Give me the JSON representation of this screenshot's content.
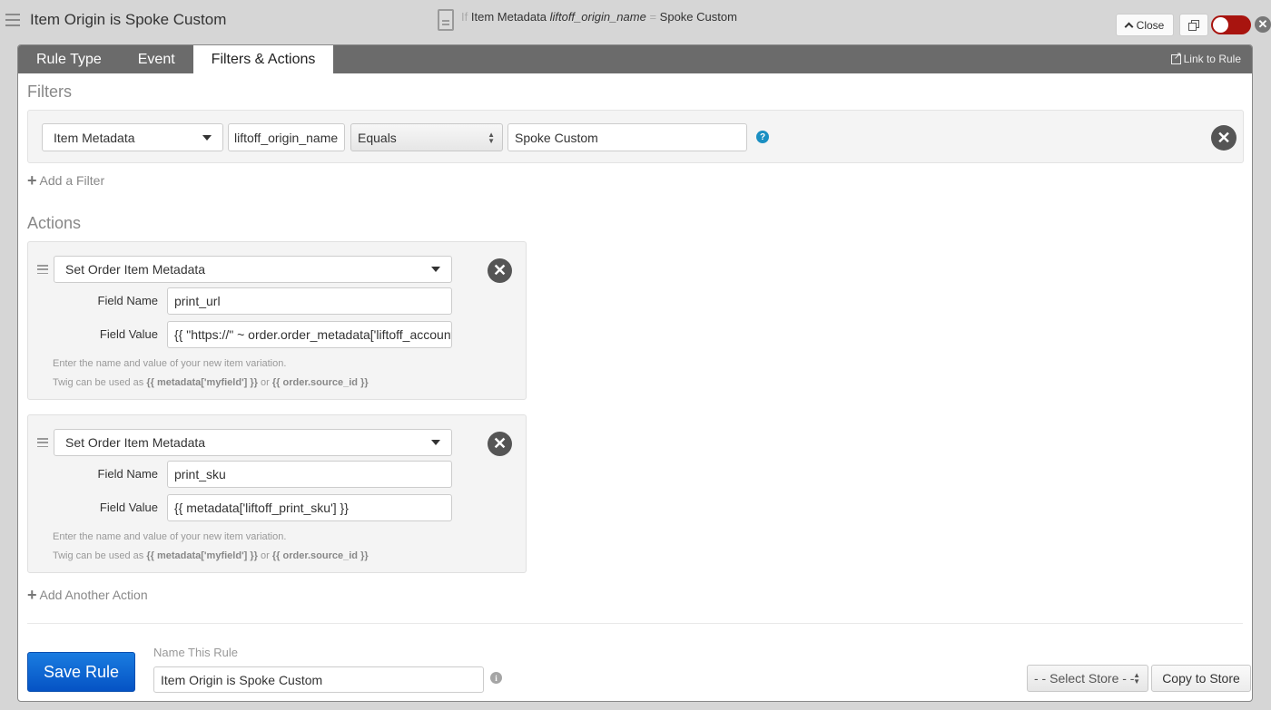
{
  "header": {
    "title": "Item Origin is Spoke Custom",
    "summary": {
      "prefix": "If",
      "subject": "Item Metadata",
      "field": "liftoff_origin_name",
      "operator": "=",
      "value": "Spoke Custom"
    },
    "close_label": "Close",
    "toggle_on": false,
    "toggle_color": "#a8140f"
  },
  "tabs": [
    {
      "label": "Rule Type",
      "active": false
    },
    {
      "label": "Event",
      "active": false
    },
    {
      "label": "Filters & Actions",
      "active": true
    }
  ],
  "link_to_rule": "Link to Rule",
  "filters": {
    "title": "Filters",
    "items": [
      {
        "type": "Item Metadata",
        "field": "liftoff_origin_name",
        "operator": "Equals",
        "value": "Spoke Custom"
      }
    ],
    "add_label": "Add a Filter"
  },
  "actions": {
    "title": "Actions",
    "field_name_label": "Field Name",
    "field_value_label": "Field Value",
    "hint_line1": "Enter the name and value of your new item variation.",
    "hint_prefix": "Twig can be used as",
    "hint_code1": "{{ metadata['myfield'] }}",
    "hint_or": "or",
    "hint_code2": "{{ order.source_id }}",
    "items": [
      {
        "type": "Set Order Item Metadata",
        "field_name": "print_url",
        "field_value": "{{ \"https://\" ~ order.order_metadata['liftoff_account_domain'] }}"
      },
      {
        "type": "Set Order Item Metadata",
        "field_name": "print_sku",
        "field_value": "{{ metadata['liftoff_print_sku'] }}"
      }
    ],
    "add_label": "Add Another Action"
  },
  "footer": {
    "save_label": "Save Rule",
    "save_color": "#0a63d4",
    "name_label": "Name This Rule",
    "name_value": "Item Origin is Spoke Custom",
    "store_select": "- - Select Store - -",
    "copy_label": "Copy to Store"
  }
}
